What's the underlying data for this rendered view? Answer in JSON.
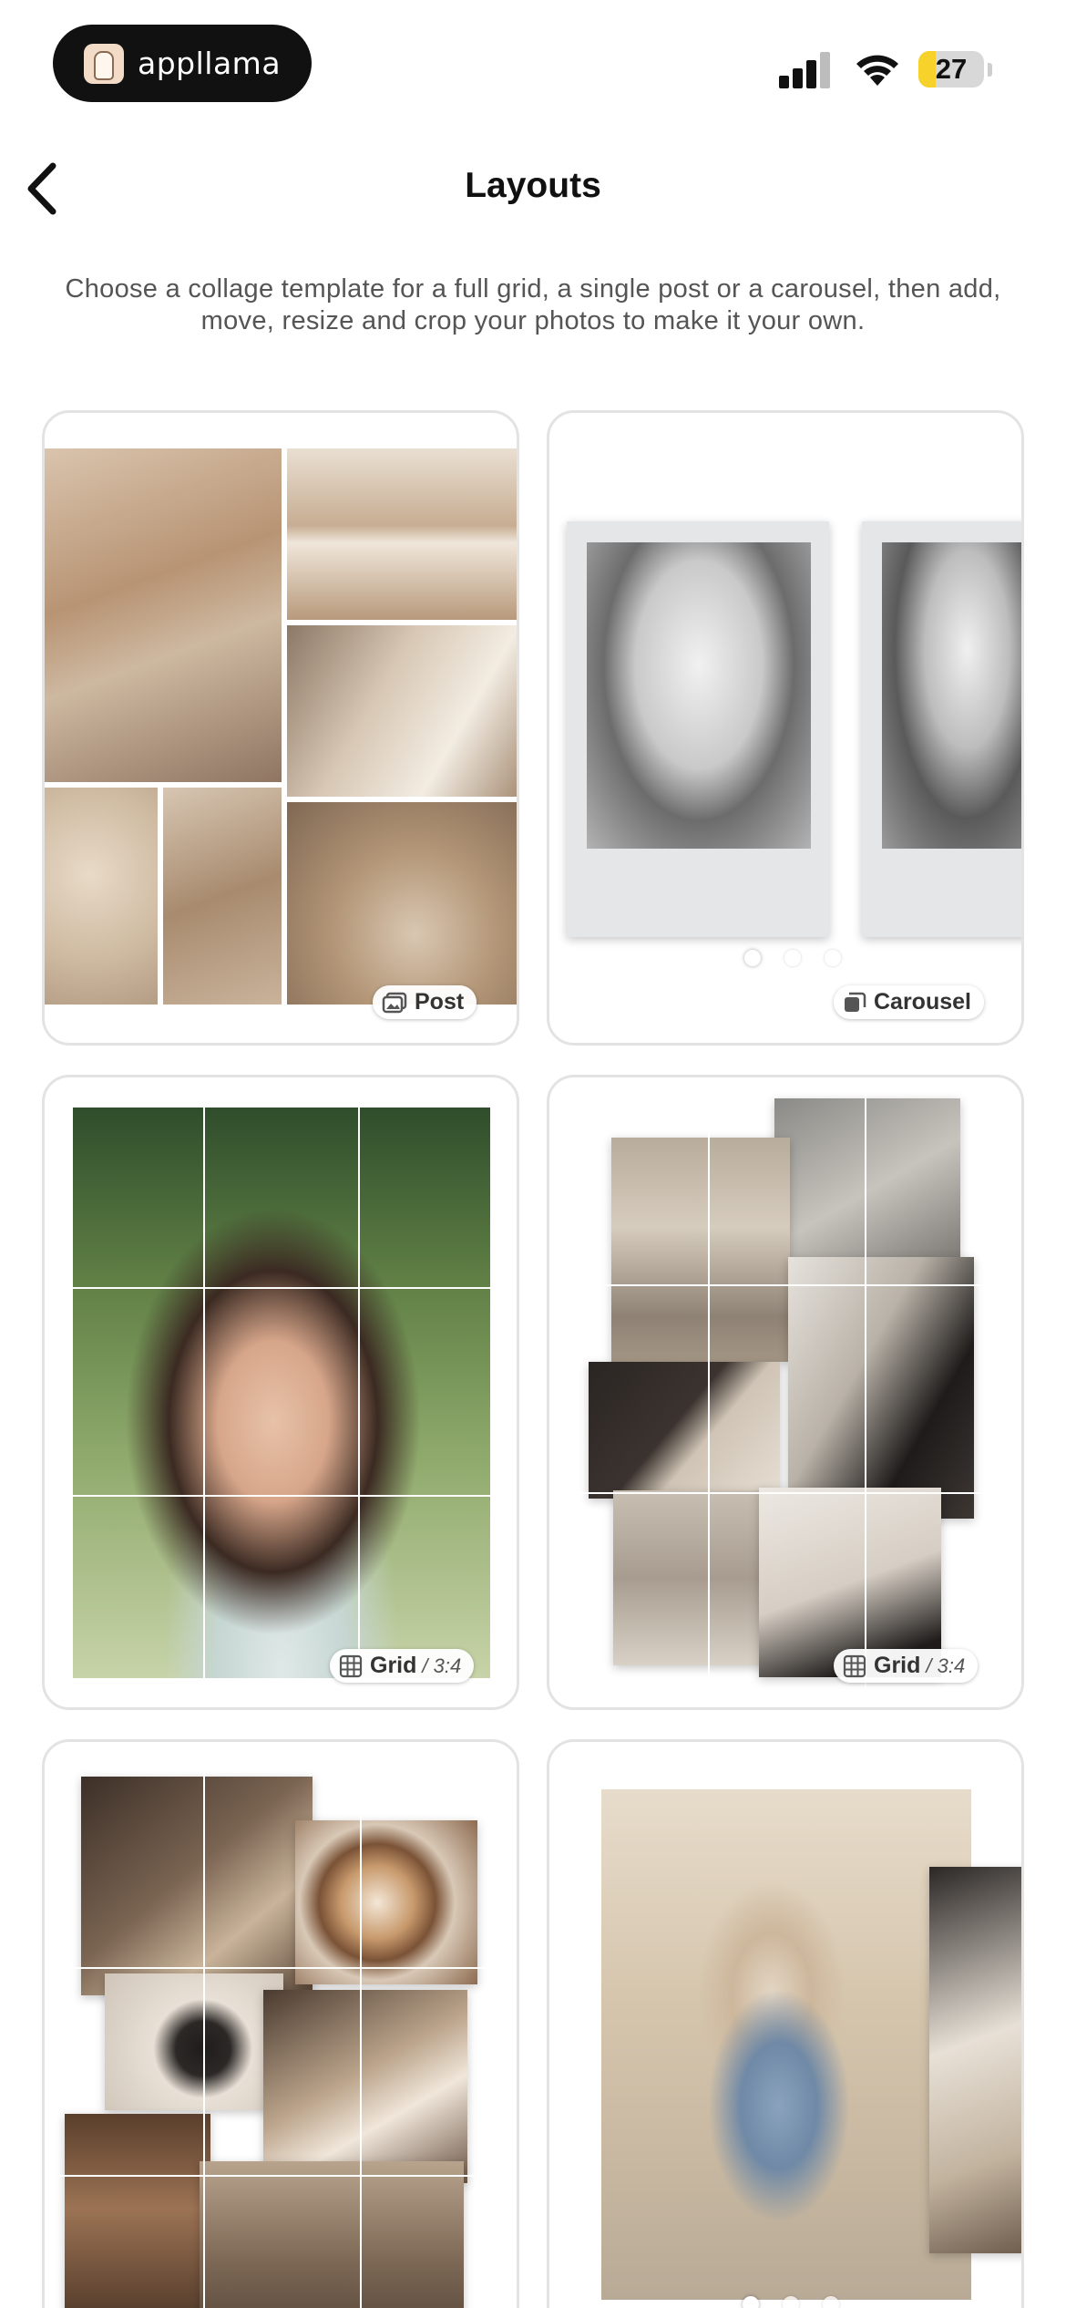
{
  "status_bar": {
    "app_name": "appllama",
    "battery_level": "27",
    "battery_fraction": 0.27,
    "signal_bars": 3
  },
  "nav": {
    "title": "Layouts",
    "back_icon": "chevron-left-icon"
  },
  "subtitle": "Choose a collage template for a full grid, a single post or a carousel, then add, move, resize and crop your photos to make it your own.",
  "templates": [
    {
      "type": "post",
      "badge": "Post",
      "icon": "post-icon"
    },
    {
      "type": "carousel",
      "badge": "Carousel",
      "icon": "carousel-icon",
      "dots": 3,
      "active_dot": 0
    },
    {
      "type": "grid",
      "badge": "Grid",
      "ratio": "/ 3:4",
      "icon": "grid-icon"
    },
    {
      "type": "grid",
      "badge": "Grid",
      "ratio": "/ 3:4",
      "icon": "grid-icon"
    },
    {
      "type": "grid",
      "badge": "",
      "icon": "grid-icon"
    },
    {
      "type": "carousel",
      "badge": "",
      "icon": "carousel-icon",
      "dots": 3,
      "active_dot": 0
    }
  ],
  "colors": {
    "accent_battery": "#f7d22a",
    "card_border": "#e3e3e3",
    "pill_bg": "#111111"
  }
}
